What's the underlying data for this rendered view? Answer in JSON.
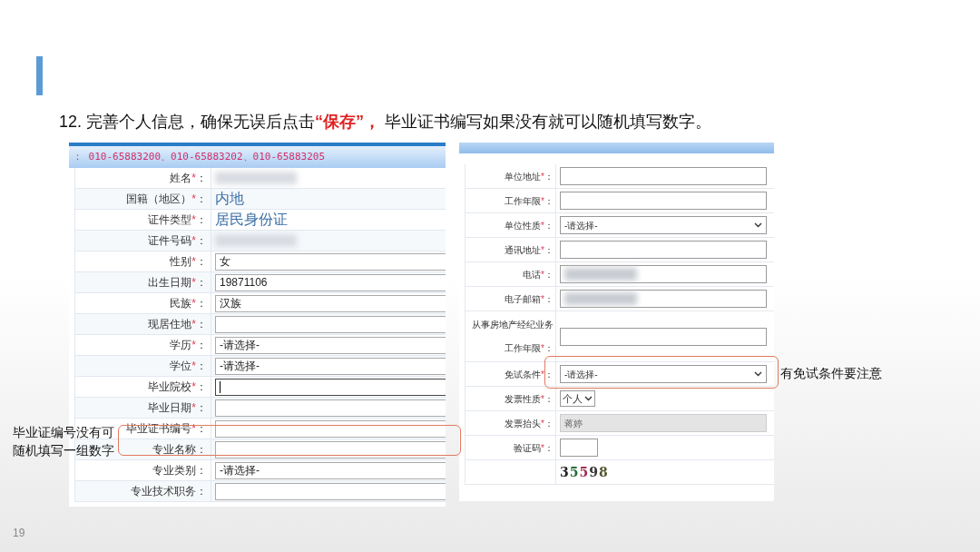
{
  "slide": {
    "instruction": "12. 完善个人信息，确保无误后点击**“保存”，** 毕业证书编写如果没有就可以随机填写数字。",
    "page_number": "19"
  },
  "required_mark": "*",
  "colon": "：",
  "left_form": {
    "header": "：  010-65883200、010-65883202、010-65883205",
    "rows": [
      {
        "label": "姓名",
        "required": true,
        "kind": "redacted"
      },
      {
        "label": "国籍（地区）",
        "required": true,
        "kind": "text",
        "value": "内地"
      },
      {
        "label": "证件类型",
        "required": true,
        "kind": "text",
        "value": "居民身份证"
      },
      {
        "label": "证件号码",
        "required": true,
        "kind": "redacted"
      },
      {
        "label": "性别",
        "required": true,
        "kind": "input",
        "value": "女"
      },
      {
        "label": "出生日期",
        "required": true,
        "kind": "input",
        "value": "19871106"
      },
      {
        "label": "民族",
        "required": true,
        "kind": "input",
        "value": "汉族"
      },
      {
        "label": "现居住地",
        "required": true,
        "kind": "input"
      },
      {
        "label": "学历",
        "required": true,
        "kind": "input",
        "value": "-请选择-"
      },
      {
        "label": "学位",
        "required": true,
        "kind": "input",
        "value": "-请选择-"
      },
      {
        "label": "毕业院校",
        "required": true,
        "kind": "input",
        "focused": true
      },
      {
        "label": "毕业日期",
        "required": true,
        "kind": "input"
      },
      {
        "label": "毕业证书编号",
        "required": true,
        "kind": "input"
      },
      {
        "label": "专业名称",
        "required": false,
        "kind": "input"
      },
      {
        "label": "专业类别",
        "required": false,
        "kind": "input",
        "value": "-请选择-"
      },
      {
        "label": "专业技术职务",
        "required": false,
        "kind": "input"
      }
    ]
  },
  "right_form": {
    "rows": [
      {
        "label": "单位地址",
        "required": true,
        "kind": "input"
      },
      {
        "label": "工作年限",
        "required": true,
        "kind": "input"
      },
      {
        "label": "单位性质",
        "required": true,
        "kind": "select",
        "value": "-请选择-"
      },
      {
        "label": "通讯地址",
        "required": true,
        "kind": "input"
      },
      {
        "label": "电话",
        "required": true,
        "kind": "redacted-input"
      },
      {
        "label": "电子邮箱",
        "required": true,
        "kind": "redacted-input"
      },
      {
        "label": "从事房地产经纪业务工作年限",
        "required": true,
        "kind": "tall-input"
      },
      {
        "label": "免试条件",
        "required": true,
        "kind": "select",
        "value": "-请选择-"
      },
      {
        "label": "发票性质",
        "required": true,
        "kind": "small-select",
        "value": "个人"
      },
      {
        "label": "发票抬头",
        "required": true,
        "kind": "disabled",
        "value": "蒋婷"
      },
      {
        "label": "验证码",
        "required": true,
        "kind": "small-input"
      },
      {
        "kind": "captcha",
        "value": "35598"
      }
    ]
  },
  "annotations": [
    {
      "text": "毕业证编号没有可随机填写一组数字"
    },
    {
      "text": "有免试条件要注意"
    }
  ]
}
